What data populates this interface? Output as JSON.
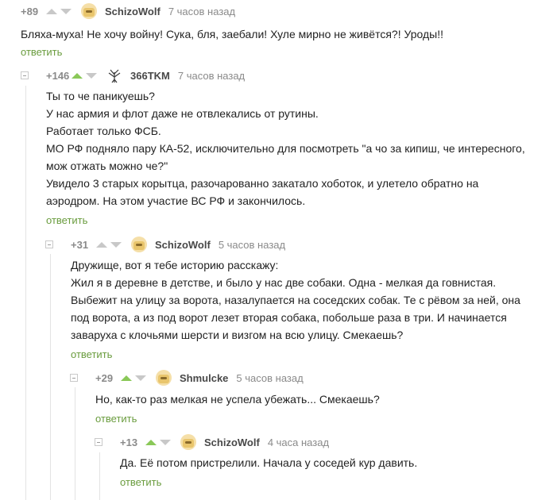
{
  "comments": [
    {
      "rating": "+89",
      "author": "SchizoWolf",
      "time": "7 часов назад",
      "reply": "ответить",
      "lines": [
        "Бляха-муха! Не хочу войну! Сука, бля, заебали! Хуле мирно не живётся?!  Уроды!!"
      ]
    },
    {
      "rating": "+146",
      "author": "366TKM",
      "time": "7 часов назад",
      "reply": "ответить",
      "lines": [
        "Ты то че паникуешь?",
        "У нас армия и флот даже не отвлекались от рутины.",
        "Работает только ФСБ.",
        "МО РФ подняло пару КА-52, исключительно для посмотреть \"а чо за кипиш, че интересного,",
        "мож отжать можно че?\"",
        "Увидело 3 старых корытца, разочарованно закатало хоботок, и улетело обратно на",
        "аэродром. На этом участие ВС РФ и закончилось."
      ]
    },
    {
      "rating": "+31",
      "author": "SchizoWolf",
      "time": "5 часов назад",
      "reply": "ответить",
      "lines": [
        "Дружище, вот я тебе историю расскажу:",
        "Жил я в деревне в детстве, и было у нас две собаки. Одна - мелкая да говнистая.",
        "Выбежит на улицу за ворота, назалупается на соседских собак. Те с рёвом за ней, она",
        "под ворота, а из под ворот лезет  вторая собака, побольше раза в три. И начинается",
        "заваруха с клочьями шерсти и визгом на всю улицу. Смекаешь?"
      ]
    },
    {
      "rating": "+29",
      "author": "Shmulcke",
      "time": "5 часов назад",
      "reply": "ответить",
      "lines": [
        "Но, как-то раз мелкая не успела убежать... Смекаешь?"
      ]
    },
    {
      "rating": "+13",
      "author": "SchizoWolf",
      "time": "4 часа назад",
      "reply": "ответить",
      "lines": [
        "Да. Её потом пристрелили. Начала у соседей кур давить."
      ]
    }
  ]
}
